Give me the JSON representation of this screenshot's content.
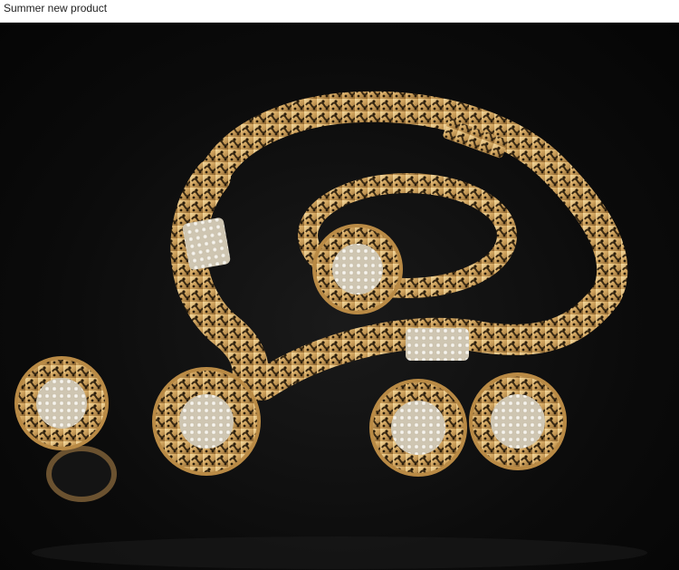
{
  "header": {
    "label": "Summer new product"
  },
  "photo": {
    "subject": "gold filigree jewelry set with crystals: necklace, bangle, ring, earrings",
    "background_color": "#0b0b0b",
    "metal_color": "#d8b06a",
    "crystal_color": "#f2efe6"
  }
}
